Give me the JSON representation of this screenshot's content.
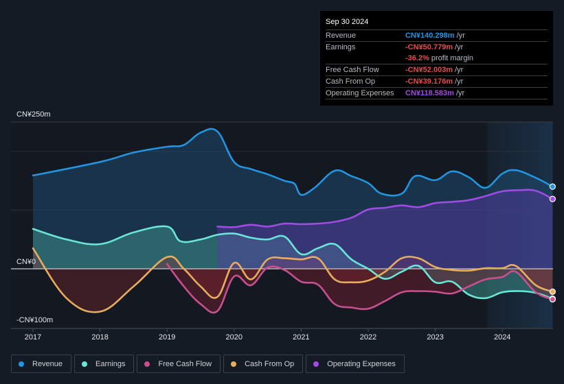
{
  "tooltip": {
    "date": "Sep 30 2024",
    "rows": [
      {
        "label": "Revenue",
        "value": "CN¥140.298m",
        "suffix": "/yr",
        "color": "#2394df"
      },
      {
        "label": "Earnings",
        "value": "-CN¥50.779m",
        "suffix": "/yr",
        "color": "#e64b4b"
      },
      {
        "label": "",
        "value": "-36.2%",
        "suffix": "profit margin",
        "color": "#e64b4b"
      },
      {
        "label": "Free Cash Flow",
        "value": "-CN¥52.003m",
        "suffix": "/yr",
        "color": "#e64b4b"
      },
      {
        "label": "Cash From Op",
        "value": "-CN¥39.176m",
        "suffix": "/yr",
        "color": "#e64b4b"
      },
      {
        "label": "Operating Expenses",
        "value": "CN¥118.583m",
        "suffix": "/yr",
        "color": "#a24ae6"
      }
    ]
  },
  "legend": [
    {
      "label": "Revenue",
      "color": "#2394df"
    },
    {
      "label": "Earnings",
      "color": "#6ae6d8"
    },
    {
      "label": "Free Cash Flow",
      "color": "#c9508f"
    },
    {
      "label": "Cash From Op",
      "color": "#e8ae5e"
    },
    {
      "label": "Operating Expenses",
      "color": "#a24ae6"
    }
  ],
  "chart_data": {
    "type": "area",
    "title": "",
    "xlabel": "",
    "ylabel": "",
    "y_unit": "CN¥m",
    "ylim": [
      -100,
      250
    ],
    "xlim": [
      2016.7,
      2024.75
    ],
    "y_tick_labels": [
      {
        "value": 250,
        "label": "CN¥250m"
      },
      {
        "value": 0,
        "label": "CN¥0"
      },
      {
        "value": -100,
        "label": "-CN¥100m"
      }
    ],
    "gridlines": [
      200,
      100
    ],
    "x_tick_labels": [
      "2017",
      "2018",
      "2019",
      "2020",
      "2021",
      "2022",
      "2023",
      "2024"
    ],
    "x_ticks": [
      2017,
      2018,
      2019,
      2020,
      2021,
      2022,
      2023,
      2024
    ],
    "highlight_range": [
      2023.77,
      2024.75
    ],
    "grid": true,
    "legend_position": "bottom",
    "series": [
      {
        "name": "Revenue",
        "color": "#2394df",
        "fill": true,
        "x": [
          2017.0,
          2018.0,
          2018.5,
          2019.0,
          2019.25,
          2019.5,
          2019.75,
          2020.0,
          2020.25,
          2020.5,
          2020.75,
          2020.9,
          2021.0,
          2021.2,
          2021.5,
          2021.75,
          2022.0,
          2022.2,
          2022.5,
          2022.7,
          2023.0,
          2023.25,
          2023.5,
          2023.75,
          2024.0,
          2024.2,
          2024.5,
          2024.75
        ],
        "y": [
          159,
          182,
          198,
          208,
          211,
          232,
          234,
          182,
          170,
          161,
          150,
          145,
          126,
          138,
          167,
          158,
          146,
          128,
          128,
          158,
          151,
          166,
          156,
          138,
          162,
          168,
          155,
          140
        ]
      },
      {
        "name": "Earnings",
        "color": "#6ae6d8",
        "fill": true,
        "x": [
          2017.0,
          2017.5,
          2018.0,
          2018.5,
          2019.0,
          2019.2,
          2019.5,
          2019.75,
          2020.0,
          2020.25,
          2020.5,
          2020.75,
          2021.0,
          2021.25,
          2021.5,
          2021.75,
          2022.0,
          2022.25,
          2022.5,
          2022.75,
          2023.0,
          2023.25,
          2023.5,
          2023.75,
          2024.0,
          2024.25,
          2024.5,
          2024.75
        ],
        "y": [
          68,
          50,
          42,
          62,
          72,
          47,
          50,
          58,
          60,
          53,
          50,
          55,
          25,
          35,
          42,
          16,
          0,
          -17,
          -5,
          5,
          -23,
          -22,
          -44,
          -50,
          -40,
          -38,
          -41,
          -51
        ]
      },
      {
        "name": "Free Cash Flow",
        "color": "#c9508f",
        "fill": true,
        "x": [
          2019.0,
          2019.25,
          2019.5,
          2019.75,
          2020.0,
          2020.25,
          2020.5,
          2020.75,
          2021.0,
          2021.25,
          2021.5,
          2021.75,
          2022.0,
          2022.25,
          2022.5,
          2022.75,
          2023.0,
          2023.25,
          2023.5,
          2023.75,
          2024.0,
          2024.2,
          2024.5,
          2024.75
        ],
        "y": [
          8,
          -30,
          -60,
          -72,
          -13,
          -28,
          2,
          -2,
          -22,
          -27,
          -60,
          -66,
          -68,
          -55,
          -40,
          -38,
          -39,
          -42,
          -30,
          -18,
          -14,
          -5,
          -40,
          -52
        ]
      },
      {
        "name": "Cash From Op",
        "color": "#e8ae5e",
        "fill": true,
        "x": [
          2017.0,
          2017.5,
          2018.0,
          2018.5,
          2019.0,
          2019.25,
          2019.5,
          2019.75,
          2020.0,
          2020.25,
          2020.5,
          2020.75,
          2021.0,
          2021.25,
          2021.5,
          2021.75,
          2022.0,
          2022.25,
          2022.5,
          2022.75,
          2023.0,
          2023.25,
          2023.5,
          2023.75,
          2024.0,
          2024.2,
          2024.5,
          2024.75
        ],
        "y": [
          35,
          -50,
          -73,
          -30,
          20,
          0,
          -30,
          -48,
          10,
          -18,
          16,
          18,
          16,
          18,
          -18,
          -23,
          -20,
          -5,
          18,
          18,
          3,
          -2,
          -3,
          1,
          1,
          5,
          -28,
          -39
        ]
      },
      {
        "name": "Operating Expenses",
        "color": "#a24ae6",
        "fill": true,
        "x": [
          2019.75,
          2020.0,
          2020.25,
          2020.5,
          2020.75,
          2021.0,
          2021.25,
          2021.5,
          2021.75,
          2022.0,
          2022.25,
          2022.5,
          2022.75,
          2023.0,
          2023.25,
          2023.5,
          2023.75,
          2024.0,
          2024.25,
          2024.5,
          2024.75
        ],
        "y": [
          72,
          71,
          75,
          72,
          77,
          76,
          77,
          80,
          87,
          101,
          104,
          108,
          105,
          112,
          114,
          117,
          124,
          132,
          134,
          133,
          119
        ]
      }
    ]
  }
}
